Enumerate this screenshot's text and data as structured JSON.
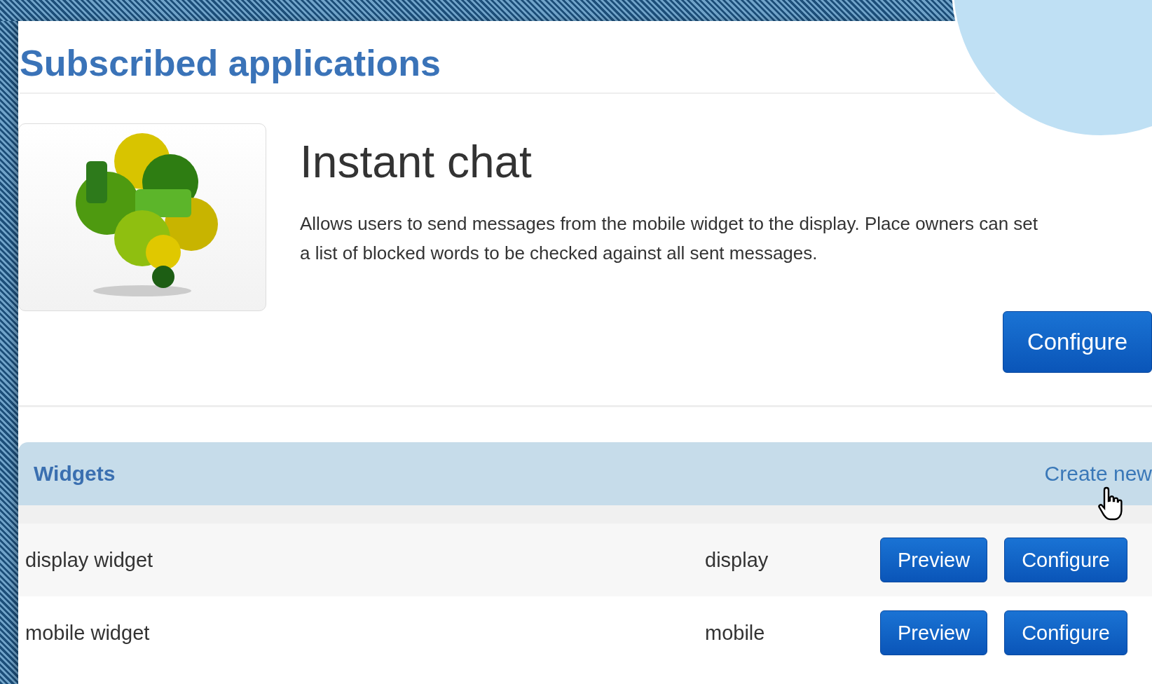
{
  "title": "Subscribed applications",
  "application": {
    "name": "Instant chat",
    "description": "Allows users to send messages from the mobile widget to the display. Place owners can set a list of blocked words to be checked against all sent messages.",
    "configure_button": "Configure"
  },
  "widgets": {
    "heading": "Widgets",
    "create_link": "Create new",
    "rows": [
      {
        "name": "display widget",
        "type": "display",
        "buttons": [
          "Preview",
          "Configure"
        ]
      },
      {
        "name": "mobile widget",
        "type": "mobile",
        "buttons": [
          "Preview",
          "Configure"
        ]
      }
    ]
  }
}
